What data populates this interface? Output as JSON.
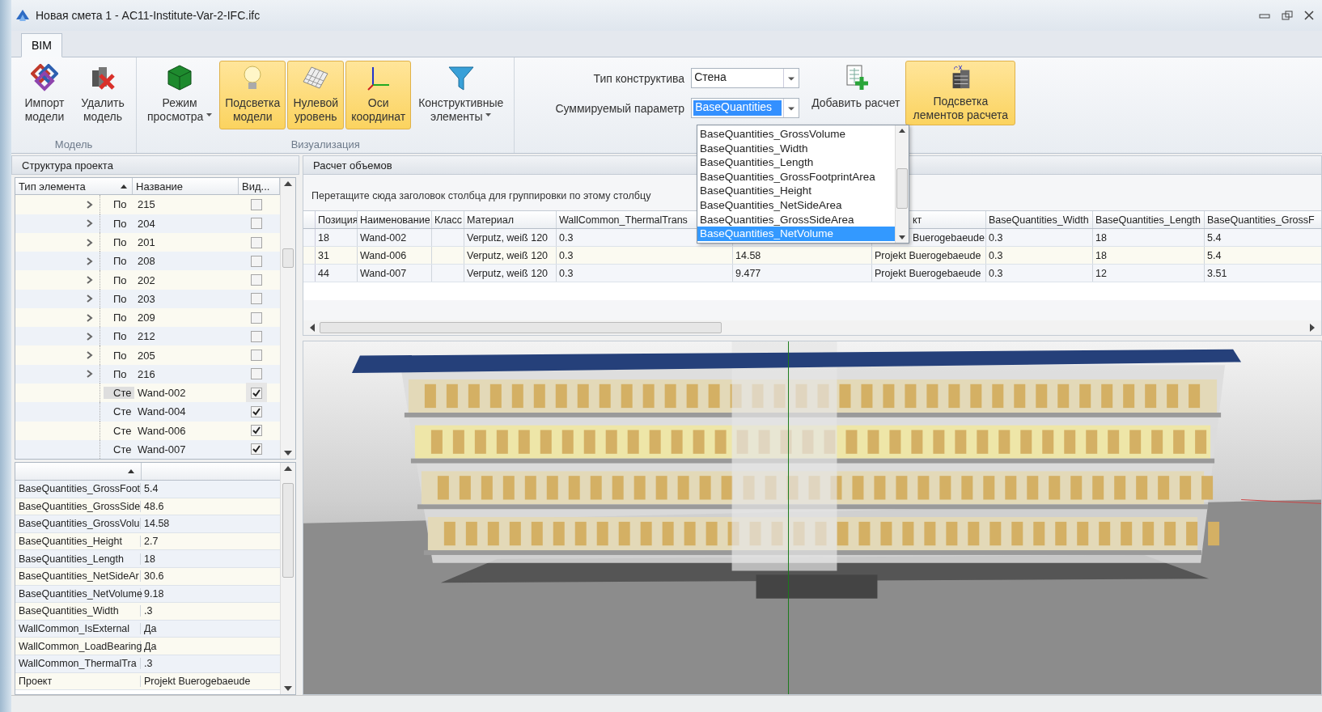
{
  "window": {
    "title": "Новая смета 1 - AC11-Institute-Var-2-IFC.ifc"
  },
  "tabs": [
    {
      "label": "BIM",
      "selected": true
    }
  ],
  "ribbon": {
    "groups": [
      {
        "label": "Модель",
        "buttons": [
          {
            "lines": [
              "Импорт",
              "модели"
            ],
            "active": false,
            "has_menu": false
          },
          {
            "lines": [
              "Удалить",
              "модель"
            ],
            "active": false,
            "has_menu": false
          }
        ]
      },
      {
        "label": "Визуализация",
        "buttons": [
          {
            "lines": [
              "Режим",
              "просмотра"
            ],
            "active": false,
            "has_menu": true
          },
          {
            "lines": [
              "Подсветка",
              "модели"
            ],
            "active": true,
            "has_menu": false
          },
          {
            "lines": [
              "Нулевой",
              "уровень"
            ],
            "active": true,
            "has_menu": false
          },
          {
            "lines": [
              "Оси",
              "координат"
            ],
            "active": true,
            "has_menu": false
          },
          {
            "lines": [
              "Конструктивные",
              "элементы"
            ],
            "active": false,
            "has_menu": true
          }
        ]
      }
    ],
    "fields": [
      {
        "label": "Тип конструктива",
        "value": "Стена",
        "focused": false
      },
      {
        "label": "Суммируемый параметр",
        "value": "BaseQuantities",
        "focused": true
      }
    ],
    "add_button": {
      "lines": [
        "Добавить расчет"
      ],
      "active": false
    },
    "highlight_button": {
      "lines": [
        "Подсветка",
        "лементов расчета"
      ],
      "active": true
    }
  },
  "dropdown": {
    "items": [
      {
        "label": "BaseQuantities_GrossVolume",
        "selected": false
      },
      {
        "label": "BaseQuantities_Width",
        "selected": false
      },
      {
        "label": "BaseQuantities_Length",
        "selected": false
      },
      {
        "label": "BaseQuantities_GrossFootprintArea",
        "selected": false
      },
      {
        "label": "BaseQuantities_Height",
        "selected": false
      },
      {
        "label": "BaseQuantities_NetSideArea",
        "selected": false
      },
      {
        "label": "BaseQuantities_GrossSideArea",
        "selected": false
      },
      {
        "label": "BaseQuantities_NetVolume",
        "selected": true
      }
    ]
  },
  "project_structure": {
    "title": "Структура проекта",
    "columns": [
      "Тип элемента",
      "Название",
      "Вид..."
    ],
    "rows": [
      {
        "type": "По",
        "name": "215",
        "expandable": true,
        "visible": false,
        "selected": false
      },
      {
        "type": "По",
        "name": "204",
        "expandable": true,
        "visible": false,
        "selected": false
      },
      {
        "type": "По",
        "name": "201",
        "expandable": true,
        "visible": false,
        "selected": false
      },
      {
        "type": "По",
        "name": "208",
        "expandable": true,
        "visible": false,
        "selected": false
      },
      {
        "type": "По",
        "name": "202",
        "expandable": true,
        "visible": false,
        "selected": false
      },
      {
        "type": "По",
        "name": "203",
        "expandable": true,
        "visible": false,
        "selected": false
      },
      {
        "type": "По",
        "name": "209",
        "expandable": true,
        "visible": false,
        "selected": false
      },
      {
        "type": "По",
        "name": "212",
        "expandable": true,
        "visible": false,
        "selected": false
      },
      {
        "type": "По",
        "name": "205",
        "expandable": true,
        "visible": false,
        "selected": false
      },
      {
        "type": "По",
        "name": "216",
        "expandable": true,
        "visible": false,
        "selected": false
      },
      {
        "type": "Сте",
        "name": "Wand-002",
        "expandable": false,
        "visible": true,
        "selected": true
      },
      {
        "type": "Сте",
        "name": "Wand-004",
        "expandable": false,
        "visible": true,
        "selected": false
      },
      {
        "type": "Сте",
        "name": "Wand-006",
        "expandable": false,
        "visible": true,
        "selected": false
      },
      {
        "type": "Сте",
        "name": "Wand-007",
        "expandable": false,
        "visible": true,
        "selected": false
      }
    ]
  },
  "properties": {
    "rows": [
      {
        "name": "BaseQuantities_GrossFoot",
        "value": "5.4"
      },
      {
        "name": "BaseQuantities_GrossSide",
        "value": "48.6"
      },
      {
        "name": "BaseQuantities_GrossVolu",
        "value": "14.58"
      },
      {
        "name": "BaseQuantities_Height",
        "value": "2.7"
      },
      {
        "name": "BaseQuantities_Length",
        "value": "18"
      },
      {
        "name": "BaseQuantities_NetSideAr",
        "value": "30.6"
      },
      {
        "name": "BaseQuantities_NetVolume",
        "value": "9.18"
      },
      {
        "name": "BaseQuantities_Width",
        "value": ".3"
      },
      {
        "name": "WallCommon_IsExternal",
        "value": "Да"
      },
      {
        "name": "WallCommon_LoadBearing",
        "value": "Да"
      },
      {
        "name": "WallCommon_ThermalTra",
        "value": ".3"
      },
      {
        "name": "Проект",
        "value": "Projekt Buerogebaeude"
      }
    ]
  },
  "volumes": {
    "title": "Расчет объемов",
    "group_hint": "Перетащите сюда заголовок столбца для группировки по этому столбцу",
    "columns": [
      "Позиция",
      "Наименование",
      "Класс",
      "Материал",
      "WallCommon_ThermalTrans",
      null,
      "кт",
      "BaseQuantities_Width",
      "BaseQuantities_Length",
      "BaseQuantities_GrossF"
    ],
    "rows": [
      [
        "18",
        "Wand-002",
        null,
        "Verputz, weiß 120",
        "0.3",
        null,
        "Buerogebaeude",
        "0.3",
        "18",
        "5.4"
      ],
      [
        "31",
        "Wand-006",
        null,
        "Verputz, weiß 120",
        "0.3",
        "14.58",
        "Projekt Buerogebaeude",
        "0.3",
        "18",
        "5.4"
      ],
      [
        "44",
        "Wand-007",
        null,
        "Verputz, weiß 120",
        "0.3",
        "9.477",
        "Projekt Buerogebaeude",
        "0.3",
        "12",
        "3.51"
      ]
    ]
  }
}
